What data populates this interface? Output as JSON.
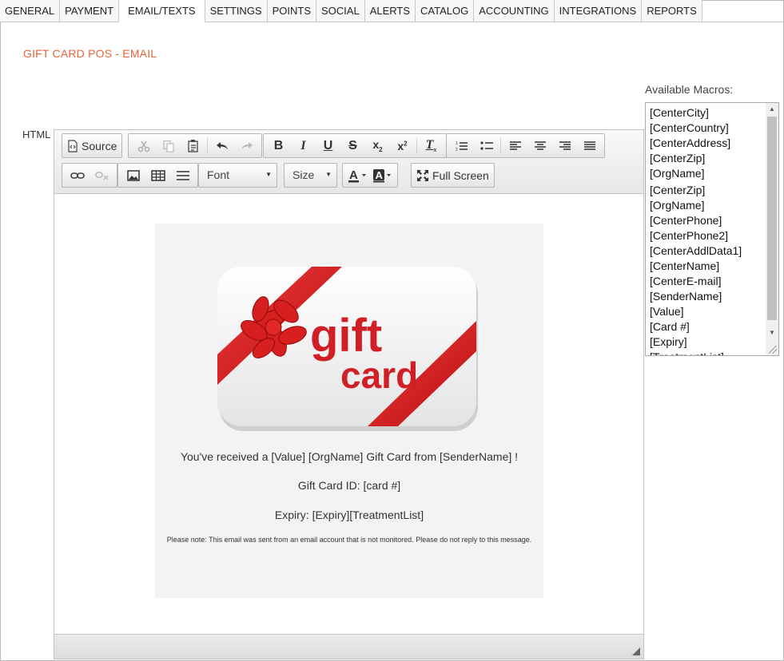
{
  "tabs": [
    "GENERAL",
    "PAYMENT",
    "EMAIL/TEXTS",
    "SETTINGS",
    "POINTS",
    "SOCIAL",
    "ALERTS",
    "CATALOG",
    "ACCOUNTING",
    "INTEGRATIONS",
    "REPORTS"
  ],
  "active_tab": "EMAIL/TEXTS",
  "page_title": "GIFT CARD POS - EMAIL",
  "html_label": "HTML",
  "macros": {
    "label": "Available Macros:",
    "items": [
      "[CenterCity]",
      "[CenterCountry]",
      "[CenterAddress]",
      "[CenterZip]",
      "[OrgName]",
      "[CenterZip]",
      "[OrgName]",
      "[CenterPhone]",
      "[CenterPhone2]",
      "[CenterAddlData1]",
      "[CenterName]",
      "[CenterE-mail]",
      "[SenderName]",
      "[Value]",
      "[Card #]",
      "[Expiry]",
      "[TreatmentList]"
    ]
  },
  "toolbar": {
    "source_label": "Source",
    "font_label": "Font",
    "size_label": "Size",
    "fullscreen_label": "Full Screen",
    "icons": [
      "source-icon",
      "cut-icon",
      "copy-icon",
      "paste-icon",
      "undo-icon",
      "redo-icon",
      "bold-icon",
      "italic-icon",
      "underline-icon",
      "strikethrough-icon",
      "subscript-icon",
      "superscript-icon",
      "remove-format-icon",
      "numbered-list-icon",
      "bulleted-list-icon",
      "align-left-icon",
      "align-center-icon",
      "align-right-icon",
      "justify-icon",
      "link-icon",
      "unlink-icon",
      "image-icon",
      "table-icon",
      "horizontal-rule-icon",
      "text-color-icon",
      "background-color-icon",
      "fullscreen-icon"
    ]
  },
  "email": {
    "logo_word1": "gift",
    "logo_word2": "card",
    "line1": "You've received a [Value] [OrgName] Gift Card from [SenderName] !",
    "line2": "Gift Card ID: [card #]",
    "line3": "Expiry: [Expiry][TreatmentList]",
    "note": "Please note: This email was sent from an email account that is not monitored. Please do not reply to this message."
  },
  "colors": {
    "title": "#e8643a",
    "ribbon": "#d81f1f",
    "logo_text": "#d11f26"
  }
}
